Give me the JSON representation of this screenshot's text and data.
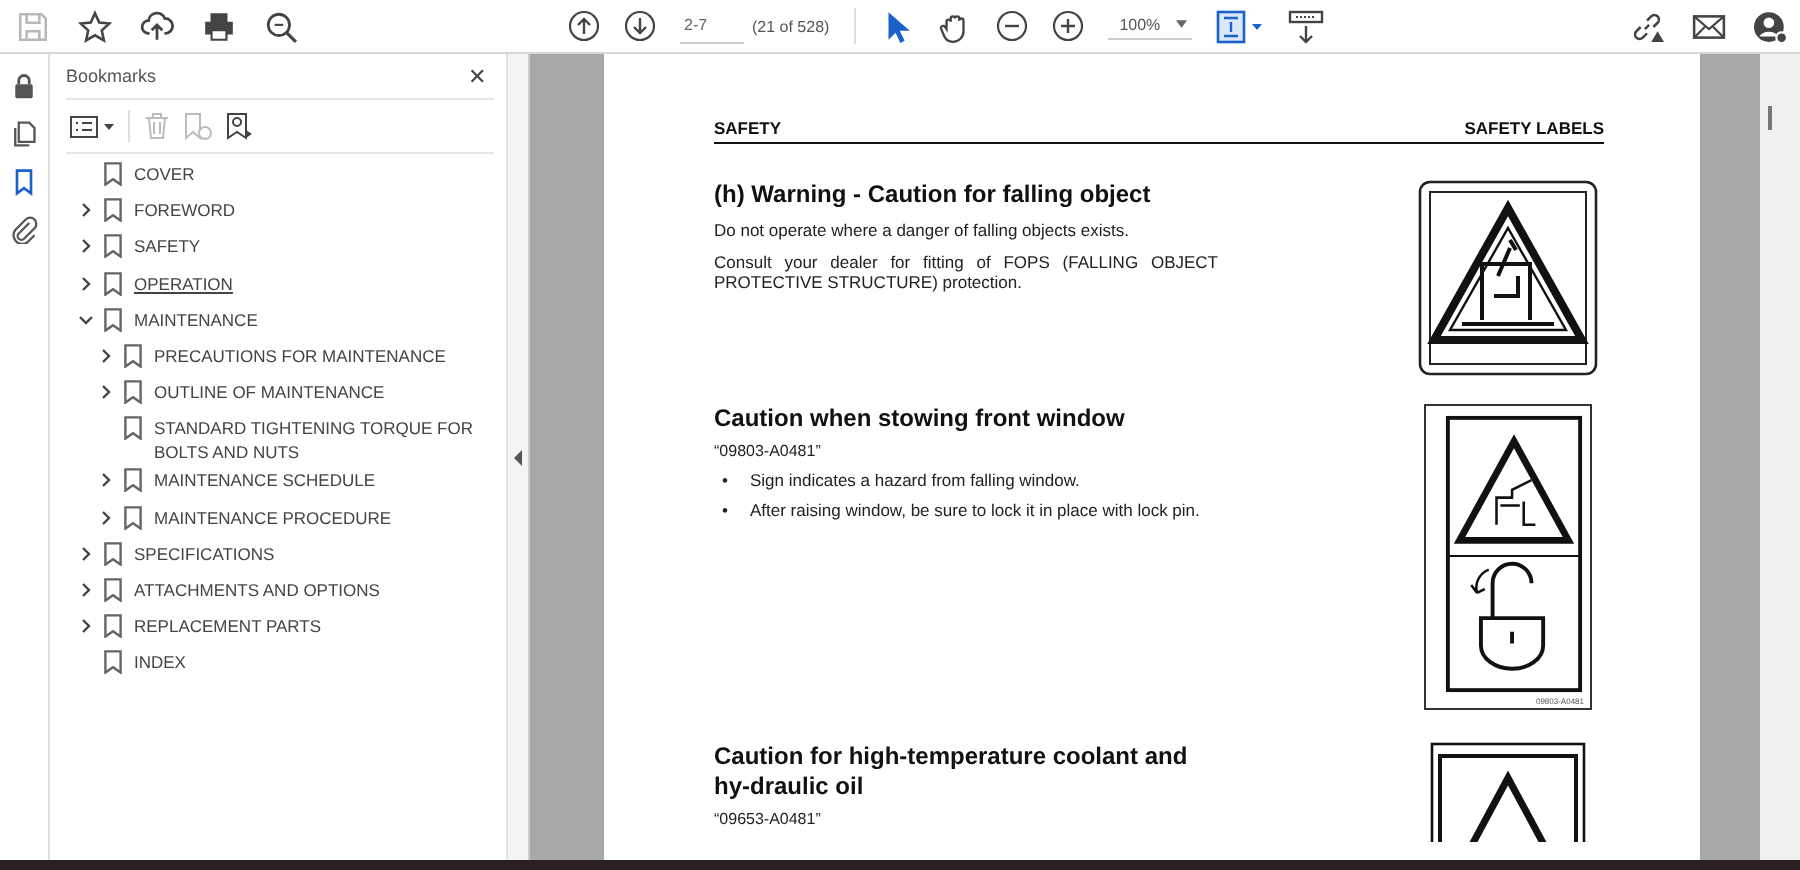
{
  "toolbar": {
    "left_tools": [
      {
        "kind": "save",
        "disabled": true
      },
      {
        "kind": "star",
        "disabled": false
      },
      {
        "kind": "upload",
        "disabled": false
      },
      {
        "kind": "print",
        "disabled": false
      },
      {
        "kind": "search",
        "disabled": false
      }
    ],
    "page_field": {
      "value": "2-7"
    },
    "page_count": "(21 of 528)",
    "tools": [
      {
        "kind": "pointer",
        "selected": true
      },
      {
        "kind": "hand",
        "selected": false
      }
    ],
    "zoom_field": {
      "value": "100%"
    }
  },
  "rail": [
    {
      "kind": "lock",
      "selected": false
    },
    {
      "kind": "pages",
      "selected": false
    },
    {
      "kind": "bookmark",
      "selected": true
    },
    {
      "kind": "clip",
      "selected": false
    }
  ],
  "bookmarks": {
    "title": "Bookmarks",
    "close": "✕",
    "items": [
      {
        "label": "COVER"
      },
      {
        "label": "FOREWORD",
        "expanded": false
      },
      {
        "label": "SAFETY",
        "expanded": false
      },
      {
        "label": "OPERATION",
        "expanded": false,
        "hovered": true
      },
      {
        "label": "MAINTENANCE",
        "expanded": true,
        "children": [
          {
            "label": "PRECAUTIONS FOR MAINTENANCE",
            "expanded": false
          },
          {
            "label": "OUTLINE OF MAINTENANCE",
            "expanded": false
          },
          {
            "label": "STANDARD TIGHTENING TORQUE FOR BOLTS AND NUTS"
          },
          {
            "label": "MAINTENANCE SCHEDULE",
            "expanded": false
          },
          {
            "label": "MAINTENANCE PROCEDURE",
            "expanded": false
          }
        ]
      },
      {
        "label": "SPECIFICATIONS",
        "expanded": false
      },
      {
        "label": "ATTACHMENTS AND OPTIONS",
        "expanded": false
      },
      {
        "label": "REPLACEMENT PARTS",
        "expanded": false
      },
      {
        "label": "INDEX"
      }
    ]
  },
  "page": {
    "header_left": "SAFETY",
    "header_right": "SAFETY LABELS",
    "sections": [
      {
        "title": "(h) Warning - Caution for falling object",
        "paragraphs": [
          "Do not operate where a danger of falling objects exists.",
          "Consult your dealer for fitting of FOPS (FALLING OBJECT PROTECTIVE STRUCTURE) protection."
        ],
        "kind": "falling"
      },
      {
        "title": "Caution when stowing front window",
        "code": "“09803-A0481”",
        "bullets": [
          {
            "marker": "•",
            "text": "Sign indicates a hazard from falling window."
          },
          {
            "marker": "•",
            "text": "After raising window, be sure to lock it in place with lock pin."
          }
        ],
        "kind": "lock",
        "sign_code": "09803-A0481"
      },
      {
        "title": "Caution for high-temperature coolant and hy-draulic oil",
        "code": "“09653-A0481”",
        "kind": "hot"
      }
    ]
  }
}
